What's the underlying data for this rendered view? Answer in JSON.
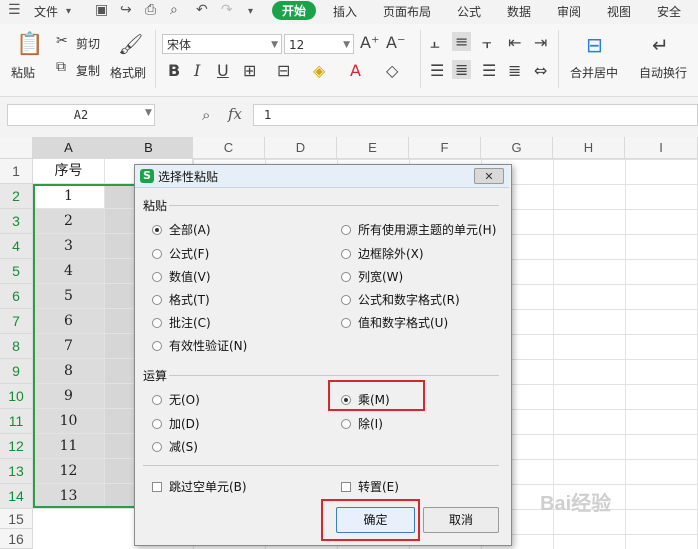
{
  "menubar": {
    "file": "文件",
    "tabs": [
      "开始",
      "插入",
      "页面布局",
      "公式",
      "数据",
      "审阅",
      "视图",
      "安全"
    ]
  },
  "ribbon": {
    "paste": "粘贴",
    "cut": "剪切",
    "copy": "复制",
    "format_painter": "格式刷",
    "font_name": "宋体",
    "font_size": "12",
    "merge_center": "合并居中",
    "auto_wrap": "自动换行"
  },
  "formula_bar": {
    "name_box": "A2",
    "fx": "fx",
    "value": "1"
  },
  "grid": {
    "columns": [
      "A",
      "B",
      "C",
      "D",
      "E",
      "F",
      "G",
      "H",
      "I"
    ],
    "rows": [
      "1",
      "2",
      "3",
      "4",
      "5",
      "6",
      "7",
      "8",
      "9",
      "10",
      "11",
      "12",
      "13",
      "14",
      "15",
      "16"
    ],
    "header_cell": "序号",
    "col_a_values": [
      "1",
      "2",
      "3",
      "4",
      "5",
      "6",
      "7",
      "8",
      "9",
      "10",
      "11",
      "12",
      "13"
    ]
  },
  "dialog": {
    "title": "选择性粘贴",
    "paste_group": "粘贴",
    "paste_left": [
      "全部(A)",
      "公式(F)",
      "数值(V)",
      "格式(T)",
      "批注(C)",
      "有效性验证(N)"
    ],
    "paste_right": [
      "所有使用源主题的单元(H)",
      "边框除外(X)",
      "列宽(W)",
      "公式和数字格式(R)",
      "值和数字格式(U)"
    ],
    "operation_group": "运算",
    "op_left": [
      "无(O)",
      "加(D)",
      "减(S)"
    ],
    "op_right": [
      "乘(M)",
      "除(I)"
    ],
    "skip_blanks": "跳过空单元(B)",
    "transpose": "转置(E)",
    "ok": "确定",
    "cancel": "取消",
    "close": "✕"
  },
  "watermark": "Bai经验",
  "colors": {
    "accent_green": "#1aa34a",
    "highlight_red": "#d9262e"
  }
}
